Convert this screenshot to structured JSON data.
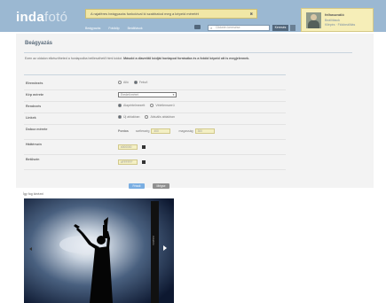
{
  "header": {
    "logo_main": "inda",
    "logo_sub": "fotó",
    "notice_text": "A rajaféres beágyazás funkcióval ki szabhatod meg a képeid méretét",
    "notice_close": "✖",
    "nav_items": [
      "Beágyazás",
      "Fotóklip",
      "Beállítások"
    ],
    "search_placeholder": "Cikkeim keresése",
    "search_button": "Keresés",
    "colors": {
      "topbar": "#9bb8d2",
      "notice": "#f1e7a6",
      "userbox": "#f6eeb8"
    }
  },
  "user": {
    "name": "felhasználó",
    "link1": "Beállítások",
    "link2": "Kilépés · Fiókbeállítás",
    "avatar_icon": "user-avatar-icon"
  },
  "main": {
    "title": "Beágyazás",
    "intro_plain": "Ezen az oldalon elkészítheted a honlapodba beilleszthető html kódot. ",
    "intro_bold": "Másold a diavetítő kódját honlapod forrásába és a fotóid képeid ott is megjelennek."
  },
  "form": {
    "rows": [
      {
        "label": "Elrendezés",
        "options": [
          "Alló",
          "Fekvő"
        ],
        "selected": 1
      },
      {
        "label": "Kép mérete",
        "select_value": "Eredeti méret"
      },
      {
        "label": "Rendezés",
        "options": [
          "Alapértelmezett",
          "Véletlenszerű"
        ],
        "selected": 0
      },
      {
        "label": "Linkek",
        "options": [
          "Új ablakban",
          "Aktuális ablakban"
        ],
        "selected": 0
      },
      {
        "label": "Doboz mérete",
        "mode": "Pontos",
        "width_label": "szélesség",
        "width_value": "400",
        "height_label": "magasság",
        "height_value": "300"
      },
      {
        "label": "Háttérszín",
        "color_value": "#000000"
      },
      {
        "label": "Betűszín",
        "color_value": "#FFFFFF"
      }
    ]
  },
  "buttons": {
    "save": "Frissít",
    "cancel": "Mégse"
  },
  "preview": {
    "label": "Így fog kinézni",
    "sidebar_text": "indafotó"
  }
}
